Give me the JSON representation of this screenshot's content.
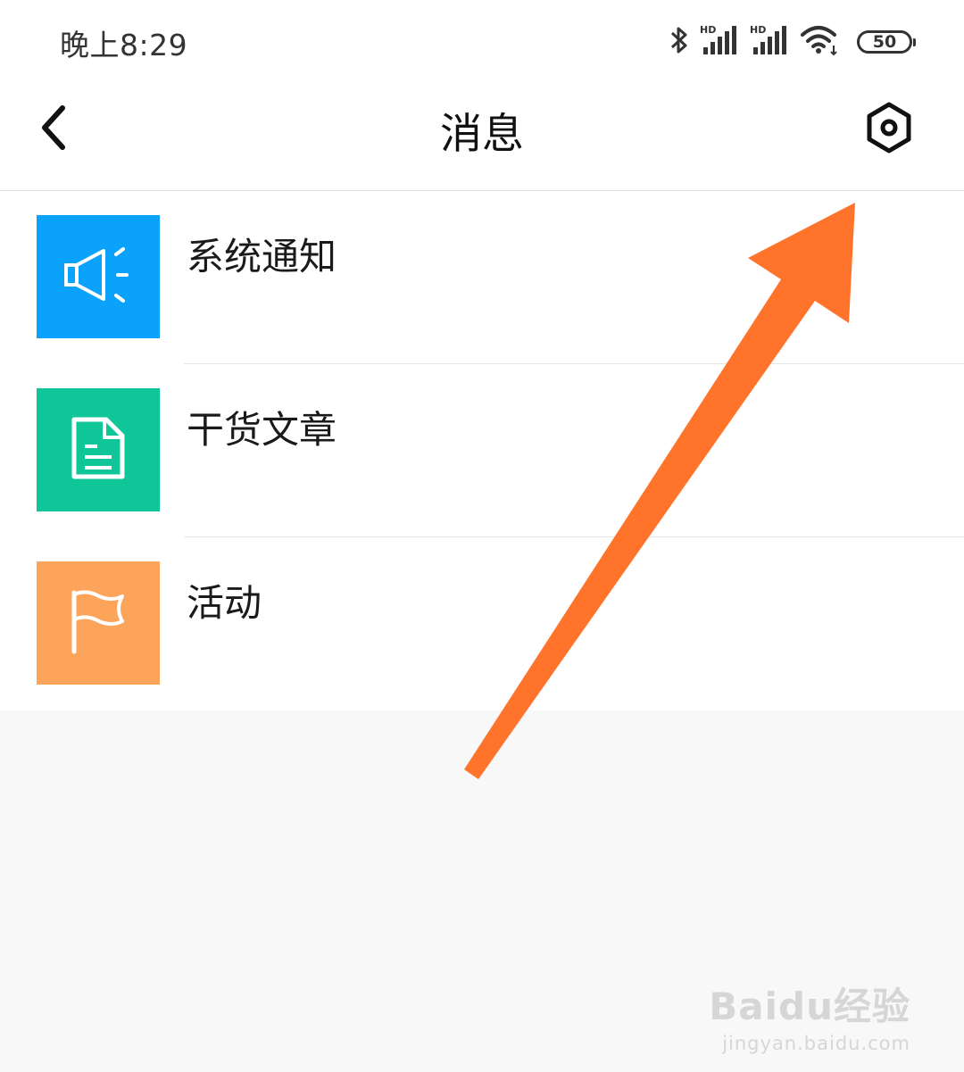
{
  "status_bar": {
    "time": "晚上8:29",
    "battery": "50",
    "icons": [
      "bluetooth-icon",
      "signal-hd-icon",
      "signal-hd-icon",
      "wifi-icon",
      "battery-icon"
    ]
  },
  "nav": {
    "title": "消息",
    "back_icon": "back-chevron-icon",
    "settings_icon": "settings-hexagon-icon"
  },
  "list": {
    "items": [
      {
        "label": "系统通知",
        "icon": "megaphone-icon",
        "color": "#0aa2fb"
      },
      {
        "label": "干货文章",
        "icon": "document-icon",
        "color": "#0fc699"
      },
      {
        "label": "活动",
        "icon": "flag-icon",
        "color": "#fda45b"
      }
    ]
  },
  "annotation": {
    "arrow_color": "#ff732b"
  },
  "watermark": {
    "main": "Baidu经验",
    "sub": "jingyan.baidu.com"
  }
}
